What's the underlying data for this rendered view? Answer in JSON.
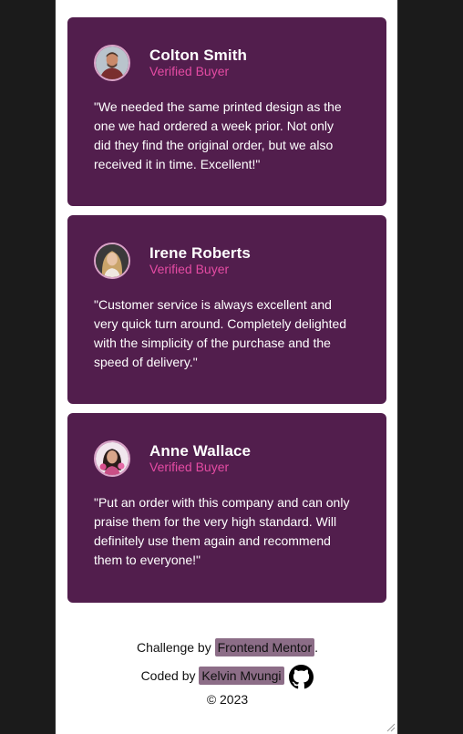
{
  "testimonials": [
    {
      "name": "Colton Smith",
      "role": "Verified Buyer",
      "quote": "\"We needed the same printed design as the one we had ordered a week prior. Not only did they find the original order, but we also received it in time. Excellent!\""
    },
    {
      "name": "Irene Roberts",
      "role": "Verified Buyer",
      "quote": "\"Customer service is always excellent and very quick turn around. Completely delighted with the simplicity of the purchase and the speed of delivery.\""
    },
    {
      "name": "Anne Wallace",
      "role": "Verified Buyer",
      "quote": "\"Put an order with this company and can only praise them for the very high standard. Will definitely use them again and recommend them to everyone!\""
    }
  ],
  "footer": {
    "challenge_prefix": "Challenge by",
    "challenge_link": "Frontend Mentor",
    "challenge_suffix": ".",
    "coded_prefix": "Coded by",
    "coded_link": "Kelvin Mvungi",
    "copyright": "© 2023"
  },
  "colors": {
    "card_bg": "#521e4d",
    "accent_pink": "#e44ba3",
    "page_bg": "#ffffff",
    "outer_bg": "#1b1b1b"
  }
}
